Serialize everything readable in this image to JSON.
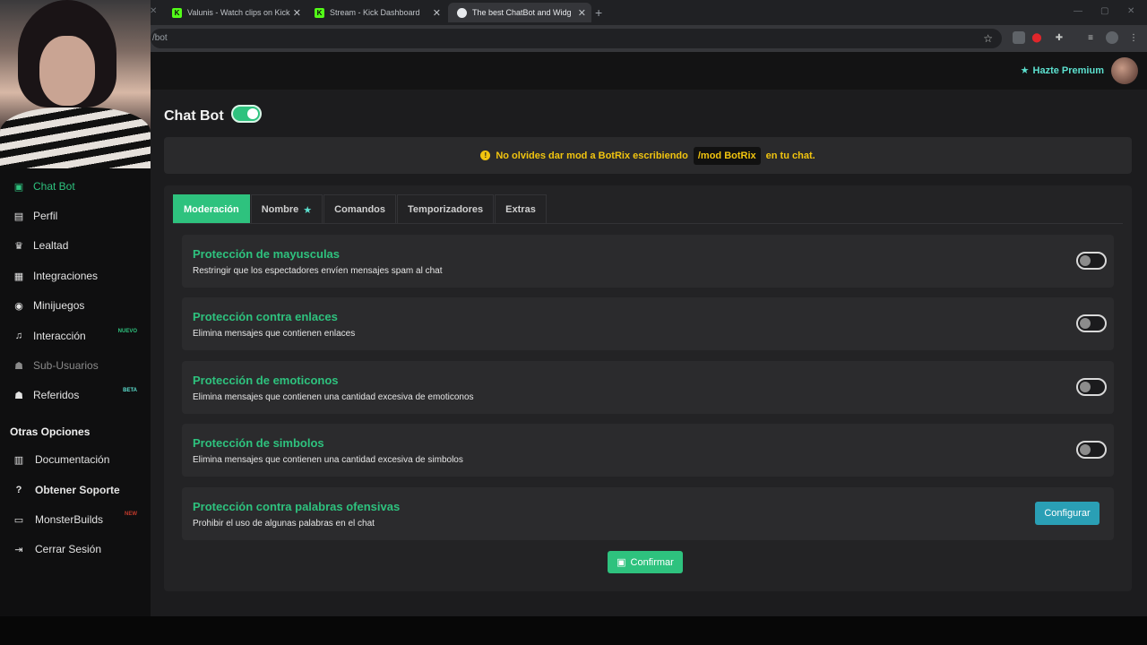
{
  "browser": {
    "tabs": [
      {
        "title": "Valunis - Watch clips on Kick"
      },
      {
        "title": "Stream - Kick Dashboard"
      },
      {
        "title": "The best ChatBot and Widgets"
      }
    ],
    "url": "/bot"
  },
  "header": {
    "premium_label": "Hazte Premium"
  },
  "sidebar": {
    "items": [
      {
        "label": "Chat Bot",
        "icon": "robot-icon"
      },
      {
        "label": "Perfil",
        "icon": "id-card-icon"
      },
      {
        "label": "Lealtad",
        "icon": "trophy-icon"
      },
      {
        "label": "Integraciones",
        "icon": "plug-icon"
      },
      {
        "label": "Minijuegos",
        "icon": "gamepad-icon"
      },
      {
        "label": "Interacción",
        "icon": "music-icon",
        "badge": "NUEVO"
      },
      {
        "label": "Sub-Usuarios",
        "icon": "users-icon"
      },
      {
        "label": "Referidos",
        "icon": "user-group-icon",
        "badge": "BETA"
      }
    ],
    "section_title": "Otras Opciones",
    "other_items": [
      {
        "label": "Documentación",
        "icon": "book-icon"
      },
      {
        "label": "Obtener Soporte",
        "icon": "question-icon"
      },
      {
        "label": "MonsterBuilds",
        "icon": "laptop-icon",
        "badge": "NEW"
      },
      {
        "label": "Cerrar Sesión",
        "icon": "sign-out-icon"
      }
    ]
  },
  "main": {
    "title": "Chat Bot",
    "enabled": true,
    "alert": {
      "prefix": "No olvides dar mod a BotRix escribiendo",
      "command": "/mod BotRix",
      "suffix": "en tu chat."
    },
    "tabs": [
      {
        "label": "Moderación",
        "active": true
      },
      {
        "label": "Nombre",
        "active": false
      },
      {
        "label": "Comandos",
        "active": false
      },
      {
        "label": "Temporizadores",
        "active": false
      },
      {
        "label": "Extras",
        "active": false
      }
    ],
    "settings": [
      {
        "title": "Protección de mayusculas",
        "description": "Restringir que los espectadores envíen mensajes spam al chat",
        "enabled": false
      },
      {
        "title": "Protección contra enlaces",
        "description": "Elimina mensajes que contienen enlaces",
        "enabled": false
      },
      {
        "title": "Protección de emoticonos",
        "description": "Elimina mensajes que contienen una cantidad excesiva de emoticonos",
        "enabled": false
      },
      {
        "title": "Protección de simbolos",
        "description": "Elimina mensajes que contienen una cantidad excesiva de simbolos",
        "enabled": false
      },
      {
        "title": "Protección contra palabras ofensivas",
        "description": "Prohibir el uso de algunas palabras en el chat",
        "button": "Configurar"
      }
    ],
    "confirm_label": "Confirmar"
  },
  "colors": {
    "accent": "#2ec27e",
    "premium": "#5ce0cf",
    "warning": "#f1c40f",
    "configure": "#2a9fb5"
  }
}
